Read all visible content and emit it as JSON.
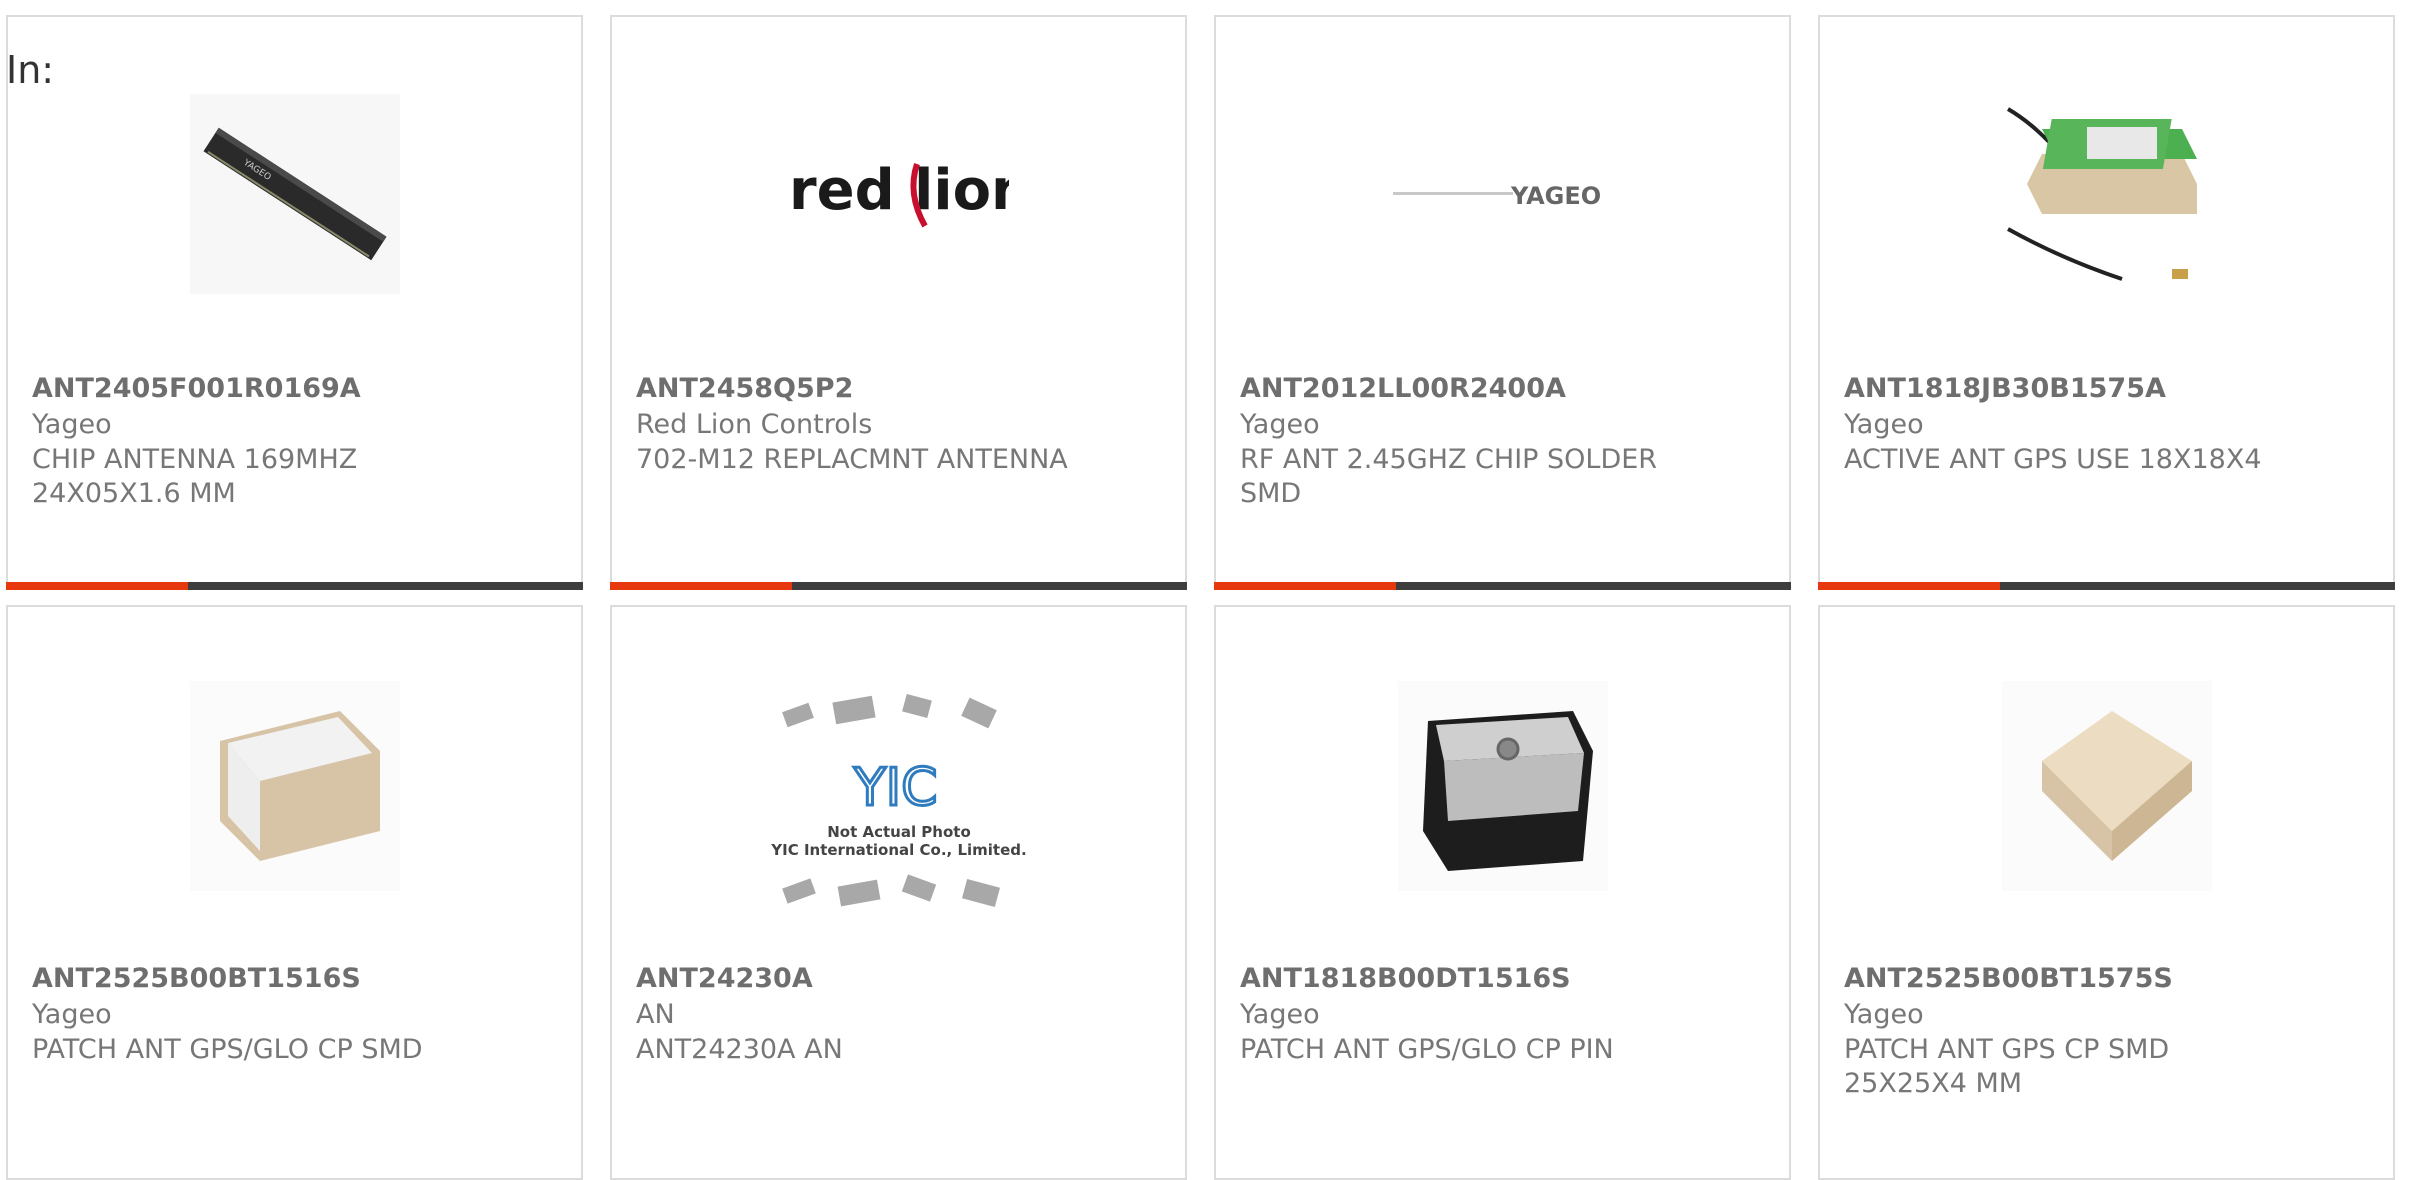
{
  "filter_label": "In:",
  "products": [
    {
      "part": "ANT2405F001R0169A",
      "mfr": "Yageo",
      "desc": [
        "CHIP ANTENNA 169MHZ",
        "24X05X1.6 MM"
      ],
      "image": "chip-antenna-image"
    },
    {
      "part": "ANT2458Q5P2",
      "mfr": "Red Lion Controls",
      "desc": [
        "702-M12 REPLACMNT ANTENNA"
      ],
      "image": "red-lion-logo",
      "logo_text": "red lion"
    },
    {
      "part": "ANT2012LL00R2400A",
      "mfr": "Yageo",
      "desc": [
        "RF ANT 2.45GHZ CHIP SOLDER",
        "SMD"
      ],
      "image": "yageo-logo",
      "logo_text": "YAGEO"
    },
    {
      "part": "ANT1818JB30B1575A",
      "mfr": "Yageo",
      "desc": [
        "ACTIVE ANT GPS USE 18X18X4"
      ],
      "image": "active-gps-antenna-image"
    },
    {
      "part": "ANT2525B00BT1516S",
      "mfr": "Yageo",
      "desc": [
        "PATCH ANT GPS/GLO CP SMD"
      ],
      "image": "patch-antenna-image"
    },
    {
      "part": "ANT24230A",
      "mfr": "AN",
      "desc": [
        "ANT24230A AN"
      ],
      "image": "yic-placeholder-image",
      "logo_text": "YIC",
      "photo_note": [
        "Not Actual Photo",
        "YIC International Co., Limited."
      ]
    },
    {
      "part": "ANT1818B00DT1516S",
      "mfr": "Yageo",
      "desc": [
        "PATCH ANT GPS/GLO CP PIN"
      ],
      "image": "black-patch-antenna-image"
    },
    {
      "part": "ANT2525B00BT1575S",
      "mfr": "Yageo",
      "desc": [
        "PATCH ANT GPS CP SMD",
        "25X25X4 MM"
      ],
      "image": "cream-patch-antenna-image"
    }
  ],
  "colors": {
    "accent": "#e8380d",
    "bar": "#3d3d3d",
    "border": "#dcdcdc"
  }
}
